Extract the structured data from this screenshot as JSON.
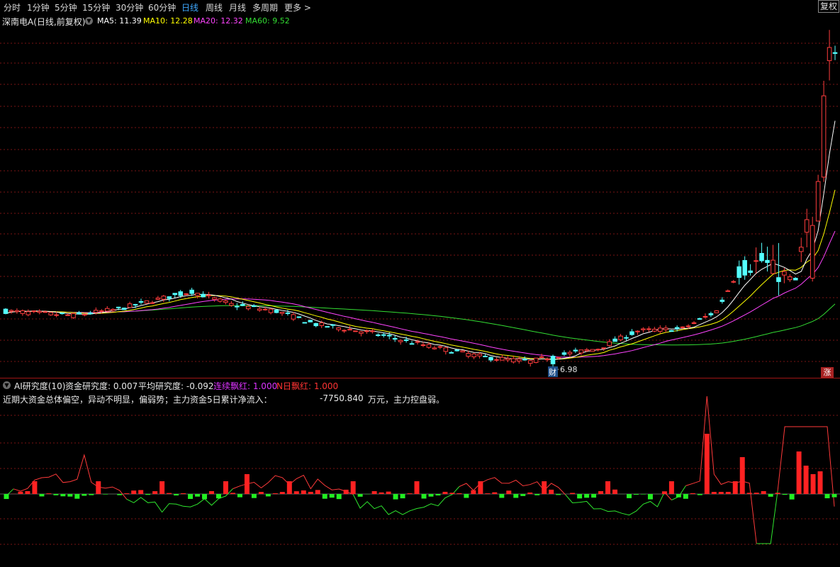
{
  "toolbar": {
    "periods": [
      "分时",
      "1分钟",
      "5分钟",
      "15分钟",
      "30分钟",
      "60分钟",
      "日线",
      "周线",
      "月线",
      "多周期",
      "更多 >"
    ],
    "active_period": "日线",
    "fq_button": "复权"
  },
  "main_chart": {
    "stock_title": "深南电A(日线,前复权)",
    "ma": [
      {
        "label": "MA5: 11.39",
        "color": "#ffffff"
      },
      {
        "label": "MA10: 12.28",
        "color": "#ffff00"
      },
      {
        "label": "MA20: 12.32",
        "color": "#ff44ff"
      },
      {
        "label": "MA60: 9.52",
        "color": "#33dd33"
      }
    ],
    "low_label": "6.98",
    "cai_badge": "财",
    "zhang_badge": "涨"
  },
  "sub_chart": {
    "indicator_name": "AI研究度(10)",
    "fields": [
      {
        "label": "资金研究度: 0.007",
        "color": "#e8e8e8"
      },
      {
        "label": "平均研究度: -0.092",
        "color": "#e8e8e8"
      },
      {
        "label": "连续飘红: 1.000",
        "color": "#dd33ff"
      },
      {
        "label": "N日飘红: 1.000",
        "color": "#ff3333"
      }
    ],
    "message_part1": "近期大资金总体偏空，异动不明显，偏弱势；主力资金5日累计净流入：",
    "message_value": "-7750.840",
    "message_part2": "万元，主力控盘弱。"
  },
  "colors": {
    "up": "#ff3d3d",
    "down": "#54ffff",
    "grid": "#7a1414",
    "ma5": "#ffffff",
    "ma10": "#ffff00",
    "ma20": "#ff44ff",
    "ma60": "#33dd33"
  },
  "chart_data": {
    "type": "candlestick",
    "y_range_estimate": [
      6.5,
      22.5
    ],
    "low_marked": 6.98,
    "candles_ohlc_sample": [
      [
        9.3,
        9.6,
        9.1,
        9.2
      ],
      [
        9.1,
        9.3,
        8.9,
        9.0
      ],
      [
        9.05,
        9.4,
        9.0,
        9.3
      ],
      [
        9.2,
        9.7,
        9.1,
        9.6
      ],
      [
        9.6,
        10.05,
        9.5,
        9.95
      ],
      [
        9.8,
        10.2,
        9.6,
        9.7
      ],
      [
        9.6,
        9.8,
        9.2,
        9.3
      ],
      [
        9.4,
        9.5,
        9.0,
        9.1
      ],
      [
        9.1,
        9.3,
        8.6,
        8.7
      ],
      [
        8.6,
        8.8,
        8.3,
        8.4
      ],
      [
        8.4,
        8.6,
        8.2,
        8.35
      ],
      [
        8.3,
        8.4,
        7.9,
        8.0
      ],
      [
        7.9,
        8.1,
        7.7,
        7.8
      ],
      [
        7.75,
        7.9,
        7.6,
        7.7
      ],
      [
        7.6,
        7.8,
        7.4,
        7.5
      ],
      [
        7.5,
        7.7,
        7.3,
        7.6
      ],
      [
        7.5,
        7.6,
        7.0,
        7.1
      ],
      [
        7.1,
        7.5,
        6.98,
        7.4
      ],
      [
        7.4,
        7.8,
        7.3,
        7.7
      ],
      [
        7.7,
        8.0,
        7.6,
        7.9
      ],
      [
        8.0,
        8.6,
        7.9,
        8.4
      ],
      [
        8.4,
        9.1,
        8.3,
        9.0
      ],
      [
        9.1,
        9.4,
        8.9,
        9.2
      ],
      [
        9.2,
        9.6,
        9.0,
        9.3
      ],
      [
        9.6,
        11.7,
        9.5,
        11.5
      ],
      [
        11.4,
        12.0,
        10.9,
        11.1
      ],
      [
        11.2,
        12.5,
        11.0,
        12.3
      ],
      [
        12.3,
        12.6,
        11.2,
        11.4
      ],
      [
        11.3,
        11.5,
        10.8,
        10.9
      ],
      [
        11.0,
        13.6,
        10.9,
        13.4
      ],
      [
        13.3,
        15.5,
        13.0,
        15.4
      ],
      [
        15.5,
        19.5,
        15.2,
        19.3
      ],
      [
        20.9,
        22.1,
        20.0,
        21.5
      ]
    ]
  }
}
